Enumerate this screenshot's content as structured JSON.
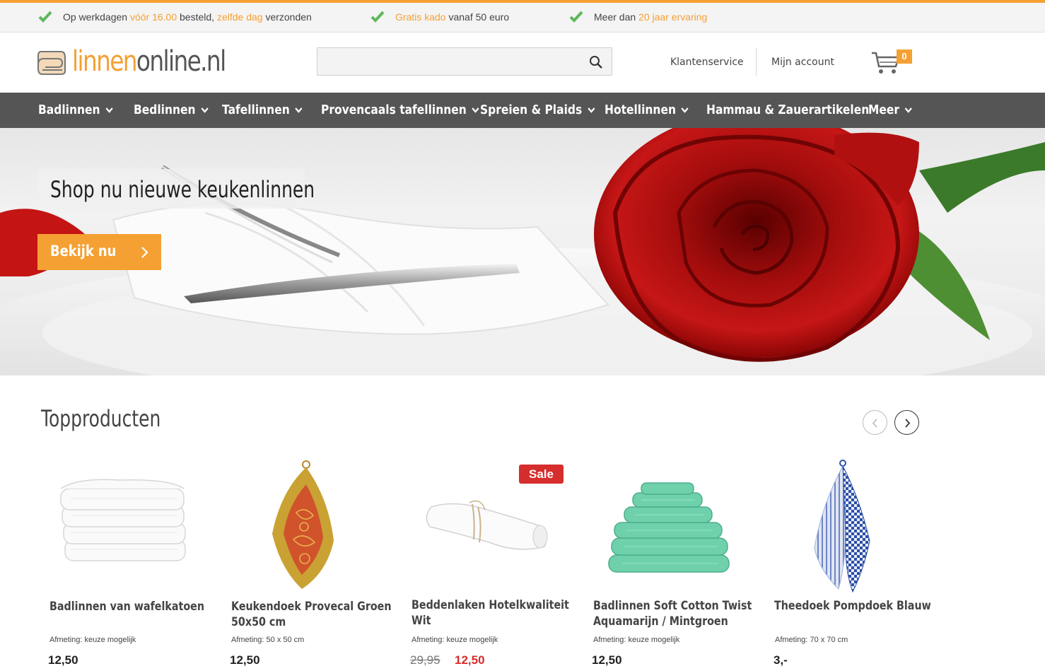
{
  "usp": [
    {
      "icon": "check-icon",
      "parts": [
        "Op werkdagen ",
        "vóór 16.00",
        " besteld, ",
        "zelfde dag",
        " verzonden"
      ]
    },
    {
      "icon": "check-icon",
      "parts": [
        "",
        "Gratis kado",
        " vanaf 50 euro"
      ]
    },
    {
      "icon": "check-icon",
      "parts": [
        "Meer dan ",
        "20 jaar ervaring",
        ""
      ]
    }
  ],
  "header": {
    "logo_part1": "linnen",
    "logo_part2": "online.nl",
    "search_placeholder": "",
    "customer_service": "Klantenservice",
    "my_account": "Mijn account",
    "cart_count": "0"
  },
  "nav": [
    {
      "label": "Badlinnen",
      "dropdown": true
    },
    {
      "label": "Bedlinnen",
      "dropdown": true
    },
    {
      "label": "Tafellinnen",
      "dropdown": true
    },
    {
      "label": "Provencaals tafellinnen",
      "dropdown": true
    },
    {
      "label": "Spreien & Plaids",
      "dropdown": true
    },
    {
      "label": "Hotellinnen",
      "dropdown": true
    },
    {
      "label": "Hammau & Zauerartikelen",
      "dropdown": false
    },
    {
      "label": "Meer",
      "dropdown": true
    }
  ],
  "hero": {
    "title": "Shop nu nieuwe keukenlinnen",
    "button": "Bekijk nu"
  },
  "top_products": {
    "title": "Topproducten",
    "sale_label": "Sale",
    "items": [
      {
        "name": "Badlinnen van wafelkatoen",
        "attr": "Afmeting: keuze mogelijk",
        "price": "12,50",
        "image": "white-waffle-towels"
      },
      {
        "name": "Keukendoek Provecal Groen 50x50 cm",
        "attr": "Afmeting: 50 x 50 cm",
        "price": "12,50",
        "image": "provencal-kitchen-towel"
      },
      {
        "name": "Beddenlaken Hotelkwaliteit Wit",
        "attr": "Afmeting: keuze mogelijk",
        "old_price": "29,95",
        "price": "12,50",
        "image": "rolled-white-sheet"
      },
      {
        "name": "Badlinnen Soft Cotton Twist Aquamarijn / Mintgroen",
        "attr": "Afmeting: keuze mogelijk",
        "price": "12,50",
        "image": "mint-towel-stack"
      },
      {
        "name": "Theedoek Pompdoek Blauw",
        "attr": "Afmeting: 70 x 70 cm",
        "price": "3,-",
        "image": "blue-checked-tea-towel"
      }
    ]
  },
  "colors": {
    "accent": "#f5a033",
    "nav_bg": "#555555",
    "check": "#5cb85c",
    "sale": "#d62d2d"
  }
}
